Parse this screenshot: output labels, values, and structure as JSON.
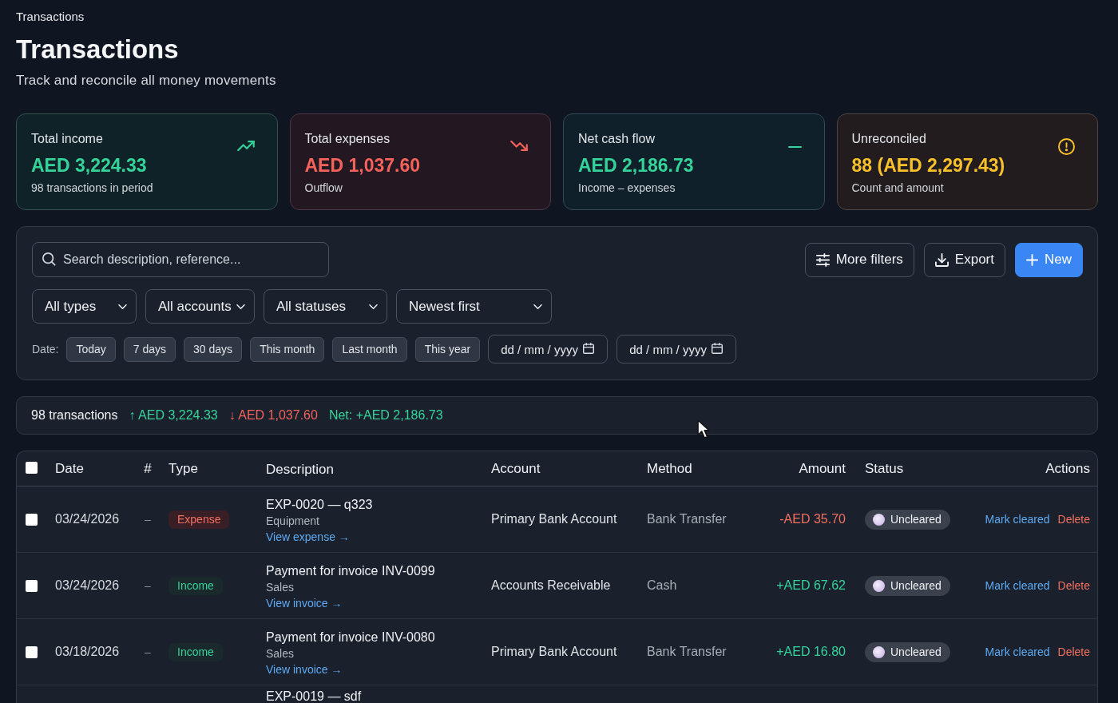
{
  "breadcrumb": "Transactions",
  "header": {
    "title": "Transactions",
    "subtitle": "Track and reconcile all money movements"
  },
  "stats": [
    {
      "kind": "income",
      "label": "Total income",
      "value": "AED 3,224.33",
      "note": "98 transactions in period"
    },
    {
      "kind": "expense",
      "label": "Total expenses",
      "value": "AED 1,037.60",
      "note": "Outflow"
    },
    {
      "kind": "net",
      "label": "Net cash flow",
      "value": "AED 2,186.73",
      "note": "Income – expenses"
    },
    {
      "kind": "unreconciled",
      "label": "Unreconciled",
      "value": "88 (AED 2,297.43)",
      "note": "Count and amount"
    }
  ],
  "filters": {
    "search": {
      "placeholder": "Search description, reference..."
    },
    "actions": [
      {
        "kind": "filters",
        "label": "More filters"
      },
      {
        "kind": "export",
        "label": "Export"
      },
      {
        "kind": "new",
        "label": "New"
      }
    ],
    "selects": [
      {
        "value": "All types"
      },
      {
        "value": "All accounts"
      },
      {
        "value": "All statuses"
      },
      {
        "value": "Newest first"
      }
    ],
    "date_label": "Date:",
    "date_presets": [
      {
        "label": "Today",
        "selected": false
      },
      {
        "label": "7 days",
        "selected": false
      },
      {
        "label": "30 days",
        "selected": false
      },
      {
        "label": "This month",
        "selected": false
      },
      {
        "label": "Last month",
        "selected": false
      },
      {
        "label": "This year",
        "selected": false
      }
    ],
    "date_fields": [
      {
        "placeholder": "dd / mm / yyyy"
      },
      {
        "placeholder": "dd / mm / yyyy"
      }
    ]
  },
  "summary": {
    "count": "98 transactions",
    "inflow": "↑ AED 3,224.33",
    "outflow": "↓ AED 1,037.60",
    "net": "Net: +AED 2,186.73"
  },
  "table": {
    "select_all": {
      "checked": false
    },
    "columns": [
      {
        "label": "Date"
      },
      {
        "label": "#"
      },
      {
        "label": "Type"
      },
      {
        "label": "Description"
      },
      {
        "label": "Account"
      },
      {
        "label": "Method"
      },
      {
        "label": "Amount"
      },
      {
        "label": "Status"
      },
      {
        "label": "Actions"
      }
    ],
    "rows": [
      {
        "checked": false,
        "date": "03/24/2026",
        "reference": "–",
        "kind": "expense",
        "type": "Expense",
        "description": {
          "title": "EXP-0020 — q323",
          "category": "Equipment",
          "link": "View expense →"
        },
        "account": "Primary Bank Account",
        "method": "Bank Transfer",
        "amount": "-AED 35.70",
        "status": "Uncleared",
        "cleared": false,
        "actions": [
          {
            "kind": "primary",
            "label": "Mark cleared"
          },
          {
            "kind": "danger",
            "label": "Delete"
          }
        ]
      },
      {
        "checked": false,
        "date": "03/24/2026",
        "reference": "–",
        "kind": "income",
        "type": "Income",
        "description": {
          "title": "Payment for invoice INV-0099",
          "category": "Sales",
          "link": "View invoice →"
        },
        "account": "Accounts Receivable",
        "method": "Cash",
        "amount": "+AED 67.62",
        "status": "Uncleared",
        "cleared": false,
        "actions": [
          {
            "kind": "primary",
            "label": "Mark cleared"
          },
          {
            "kind": "danger",
            "label": "Delete"
          }
        ]
      },
      {
        "checked": false,
        "date": "03/18/2026",
        "reference": "–",
        "kind": "income",
        "type": "Income",
        "description": {
          "title": "Payment for invoice INV-0080",
          "category": "Sales",
          "link": "View invoice →"
        },
        "account": "Primary Bank Account",
        "method": "Bank Transfer",
        "amount": "+AED 16.80",
        "status": "Uncleared",
        "cleared": false,
        "actions": [
          {
            "kind": "primary",
            "label": "Mark cleared"
          },
          {
            "kind": "danger",
            "label": "Delete"
          }
        ]
      },
      {
        "description": {
          "title": "EXP-0019 — sdf"
        }
      }
    ]
  }
}
